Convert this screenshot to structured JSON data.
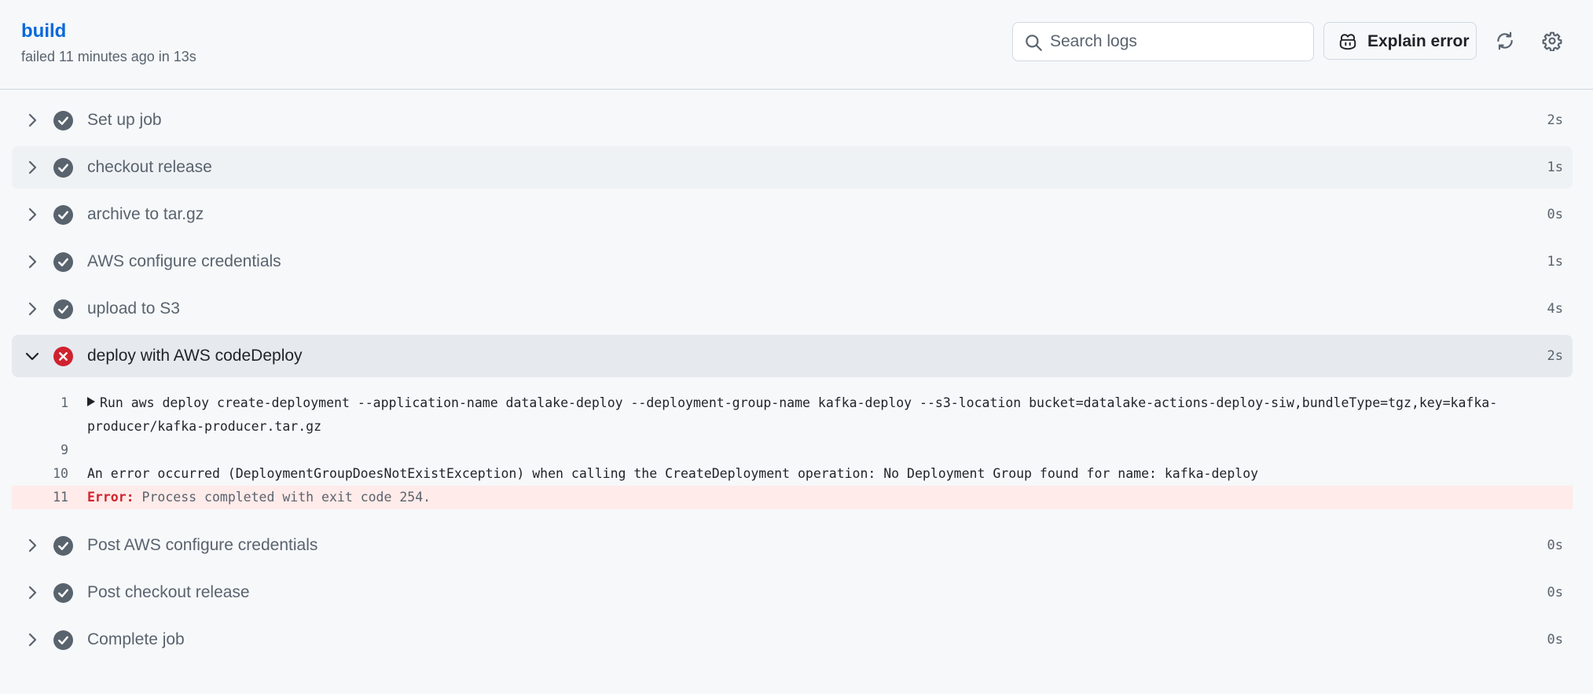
{
  "header": {
    "title": "build",
    "subtitle": "failed 11 minutes ago in 13s",
    "search_placeholder": "Search logs",
    "explain_label": "Explain error"
  },
  "steps": [
    {
      "name": "Set up job",
      "duration": "2s",
      "status": "success"
    },
    {
      "name": "checkout release",
      "duration": "1s",
      "status": "success"
    },
    {
      "name": "archive to tar.gz",
      "duration": "0s",
      "status": "success"
    },
    {
      "name": "AWS configure credentials",
      "duration": "1s",
      "status": "success"
    },
    {
      "name": "upload to S3",
      "duration": "4s",
      "status": "success"
    },
    {
      "name": "deploy with AWS codeDeploy",
      "duration": "2s",
      "status": "failure"
    },
    {
      "name": "Post AWS configure credentials",
      "duration": "0s",
      "status": "success"
    },
    {
      "name": "Post checkout release",
      "duration": "0s",
      "status": "success"
    },
    {
      "name": "Complete job",
      "duration": "0s",
      "status": "success"
    }
  ],
  "log": [
    {
      "line": "1",
      "text": "Run aws deploy create-deployment --application-name datalake-deploy --deployment-group-name kafka-deploy --s3-location bucket=datalake-actions-deploy-siw,bundleType=tgz,key=kafka-producer/kafka-producer.tar.gz"
    },
    {
      "line": "9",
      "text": ""
    },
    {
      "line": "10",
      "text": "An error occurred (DeploymentGroupDoesNotExistException) when calling the CreateDeployment operation: No Deployment Group found for name: kafka-deploy"
    },
    {
      "line": "11",
      "error_label": "Error:",
      "text": "Process completed with exit code 254."
    }
  ],
  "colors": {
    "success": "#59636e",
    "failure": "#cf222e",
    "link": "#0969da"
  }
}
